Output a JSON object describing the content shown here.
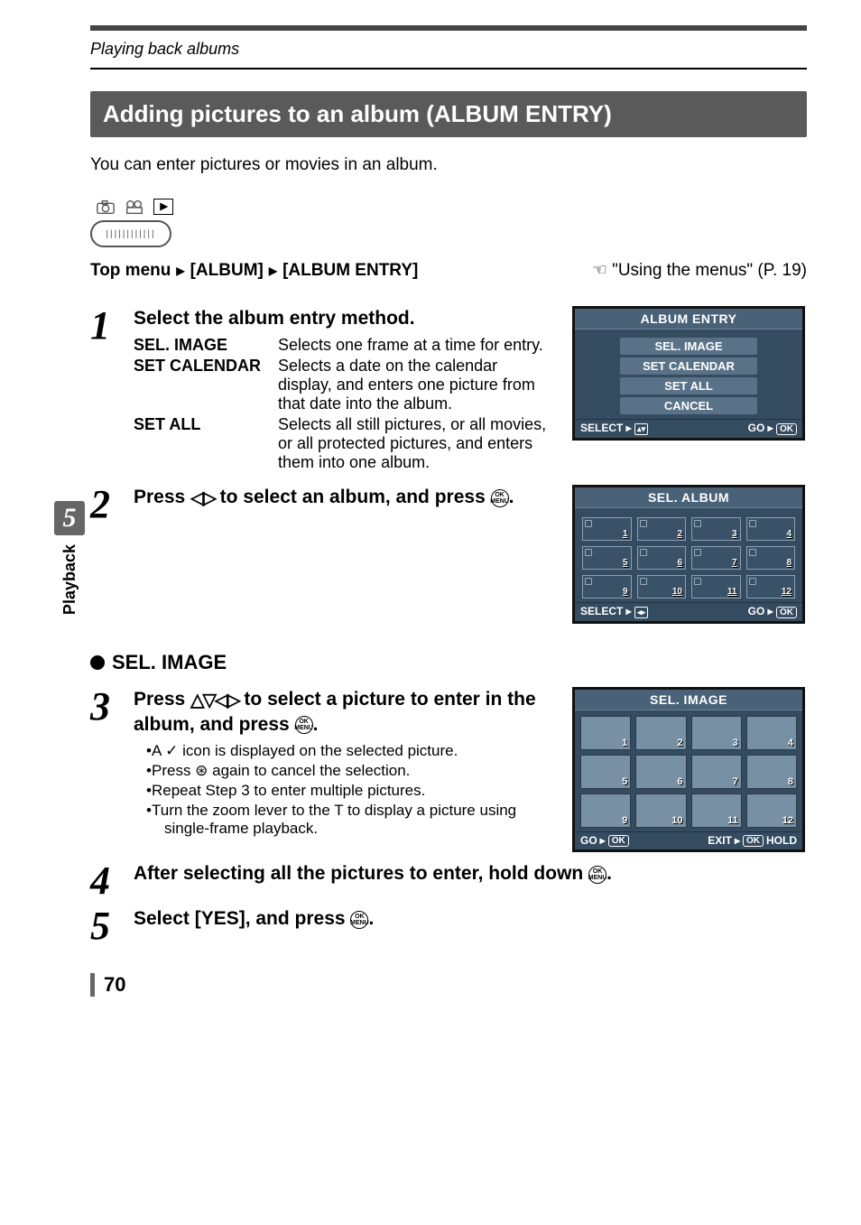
{
  "header": {
    "breadcrumb": "Playing back albums"
  },
  "section": {
    "title": "Adding pictures to an album (ALBUM ENTRY)",
    "intro": "You can enter pictures or movies in an album."
  },
  "menu_path": {
    "prefix": "Top menu",
    "item1": "[ALBUM]",
    "item2": "[ALBUM ENTRY]",
    "ref": "\"Using the menus\" (P. 19)"
  },
  "side_tab": {
    "chapter_num": "5",
    "chapter_label": "Playback"
  },
  "steps": {
    "s1": {
      "num": "1",
      "title": "Select the album entry method.",
      "defs": [
        {
          "term": "SEL. IMAGE",
          "desc": "Selects one frame at a time for entry."
        },
        {
          "term": "SET CALENDAR",
          "desc": "Selects a date on the calendar display, and enters one picture from that date into the album."
        },
        {
          "term": "SET ALL",
          "desc": "Selects all still pictures, or all movies, or all protected pictures, and enters them into one album."
        }
      ]
    },
    "s2": {
      "num": "2",
      "title_a": "Press ",
      "title_b": " to select an album, and press ",
      "title_c": "."
    },
    "subhead": "SEL. IMAGE",
    "s3": {
      "num": "3",
      "title_a": "Press ",
      "title_b": " to select a picture to enter in the album, and press ",
      "title_c": ".",
      "bullets": [
        "A ✓ icon is displayed on the selected picture.",
        "Press ⊛ again to cancel the selection.",
        "Repeat Step 3 to enter multiple pictures.",
        "Turn the zoom lever to the T to display a picture using single-frame playback."
      ]
    },
    "s4": {
      "num": "4",
      "title_a": "After selecting all the pictures to enter, hold down ",
      "title_b": "."
    },
    "s5": {
      "num": "5",
      "title_a": "Select [YES], and press ",
      "title_b": "."
    }
  },
  "screen1": {
    "title": "ALBUM ENTRY",
    "items": [
      "SEL. IMAGE",
      "SET CALENDAR",
      "SET ALL",
      "CANCEL"
    ],
    "foot_left": "SELECT",
    "foot_right": "GO",
    "ok": "OK"
  },
  "screen2": {
    "title": "SEL. ALBUM",
    "slots": [
      "1",
      "2",
      "3",
      "4",
      "5",
      "6",
      "7",
      "8",
      "9",
      "10",
      "11",
      "12"
    ],
    "foot_left": "SELECT",
    "foot_right": "GO",
    "ok": "OK"
  },
  "screen3": {
    "title": "SEL. IMAGE",
    "thumbs": [
      "1",
      "2",
      "3",
      "4",
      "5",
      "6",
      "7",
      "8",
      "9",
      "10",
      "11",
      "12"
    ],
    "foot_go": "GO",
    "foot_exit": "EXIT",
    "foot_hold": "HOLD",
    "ok": "OK"
  },
  "page_number": "70"
}
